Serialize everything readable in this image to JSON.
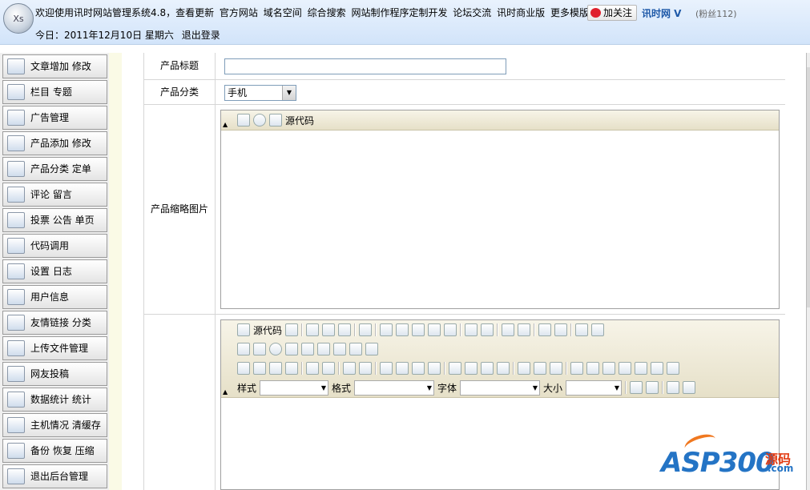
{
  "header": {
    "logo_text": "Xs",
    "nav_items": [
      "欢迎使用讯时网站管理系统4.8，查看更新",
      "官方网站",
      "域名空间",
      "综合搜索",
      "网站制作程序定制开发",
      "论坛交流",
      "讯时商业版",
      "更多模版"
    ],
    "follow_label": "加关注",
    "brand": "讯时网 V",
    "fans": "(粉丝112)",
    "date_text": "今日：2011年12月10日 星期六",
    "logout": "退出登录"
  },
  "sidebar": {
    "items": [
      {
        "label": "文章增加 修改",
        "icon": "article-add-icon"
      },
      {
        "label": "栏目 专题",
        "icon": "column-icon"
      },
      {
        "label": "广告管理",
        "icon": "ad-icon"
      },
      {
        "label": "产品添加 修改",
        "icon": "product-icon"
      },
      {
        "label": "产品分类 定单",
        "icon": "category-icon"
      },
      {
        "label": "评论 留言",
        "icon": "comment-icon"
      },
      {
        "label": "投票 公告 单页",
        "icon": "vote-icon"
      },
      {
        "label": "代码调用",
        "icon": "code-icon"
      },
      {
        "label": "设置 日志",
        "icon": "settings-icon"
      },
      {
        "label": "用户信息",
        "icon": "user-icon"
      },
      {
        "label": "友情链接 分类",
        "icon": "link-icon"
      },
      {
        "label": "上传文件管理",
        "icon": "upload-icon"
      },
      {
        "label": "网友投稿",
        "icon": "submit-icon"
      },
      {
        "label": "数据统计 统计",
        "icon": "stats-icon"
      },
      {
        "label": "主机情况 清缓存",
        "icon": "host-icon"
      },
      {
        "label": "备份 恢复 压缩",
        "icon": "backup-icon"
      },
      {
        "label": "退出后台管理",
        "icon": "exit-icon"
      }
    ]
  },
  "form": {
    "title_label": "产品标题",
    "title_value": "",
    "category_label": "产品分类",
    "category_value": "手机",
    "thumb_label": "产品缩略图片",
    "source_label": "源代码",
    "toolbar_style": "样式",
    "toolbar_format": "格式",
    "toolbar_font": "字体",
    "toolbar_size": "大小"
  },
  "watermark": {
    "main": "ASP300",
    "cn": "源码",
    "com": ".com"
  }
}
